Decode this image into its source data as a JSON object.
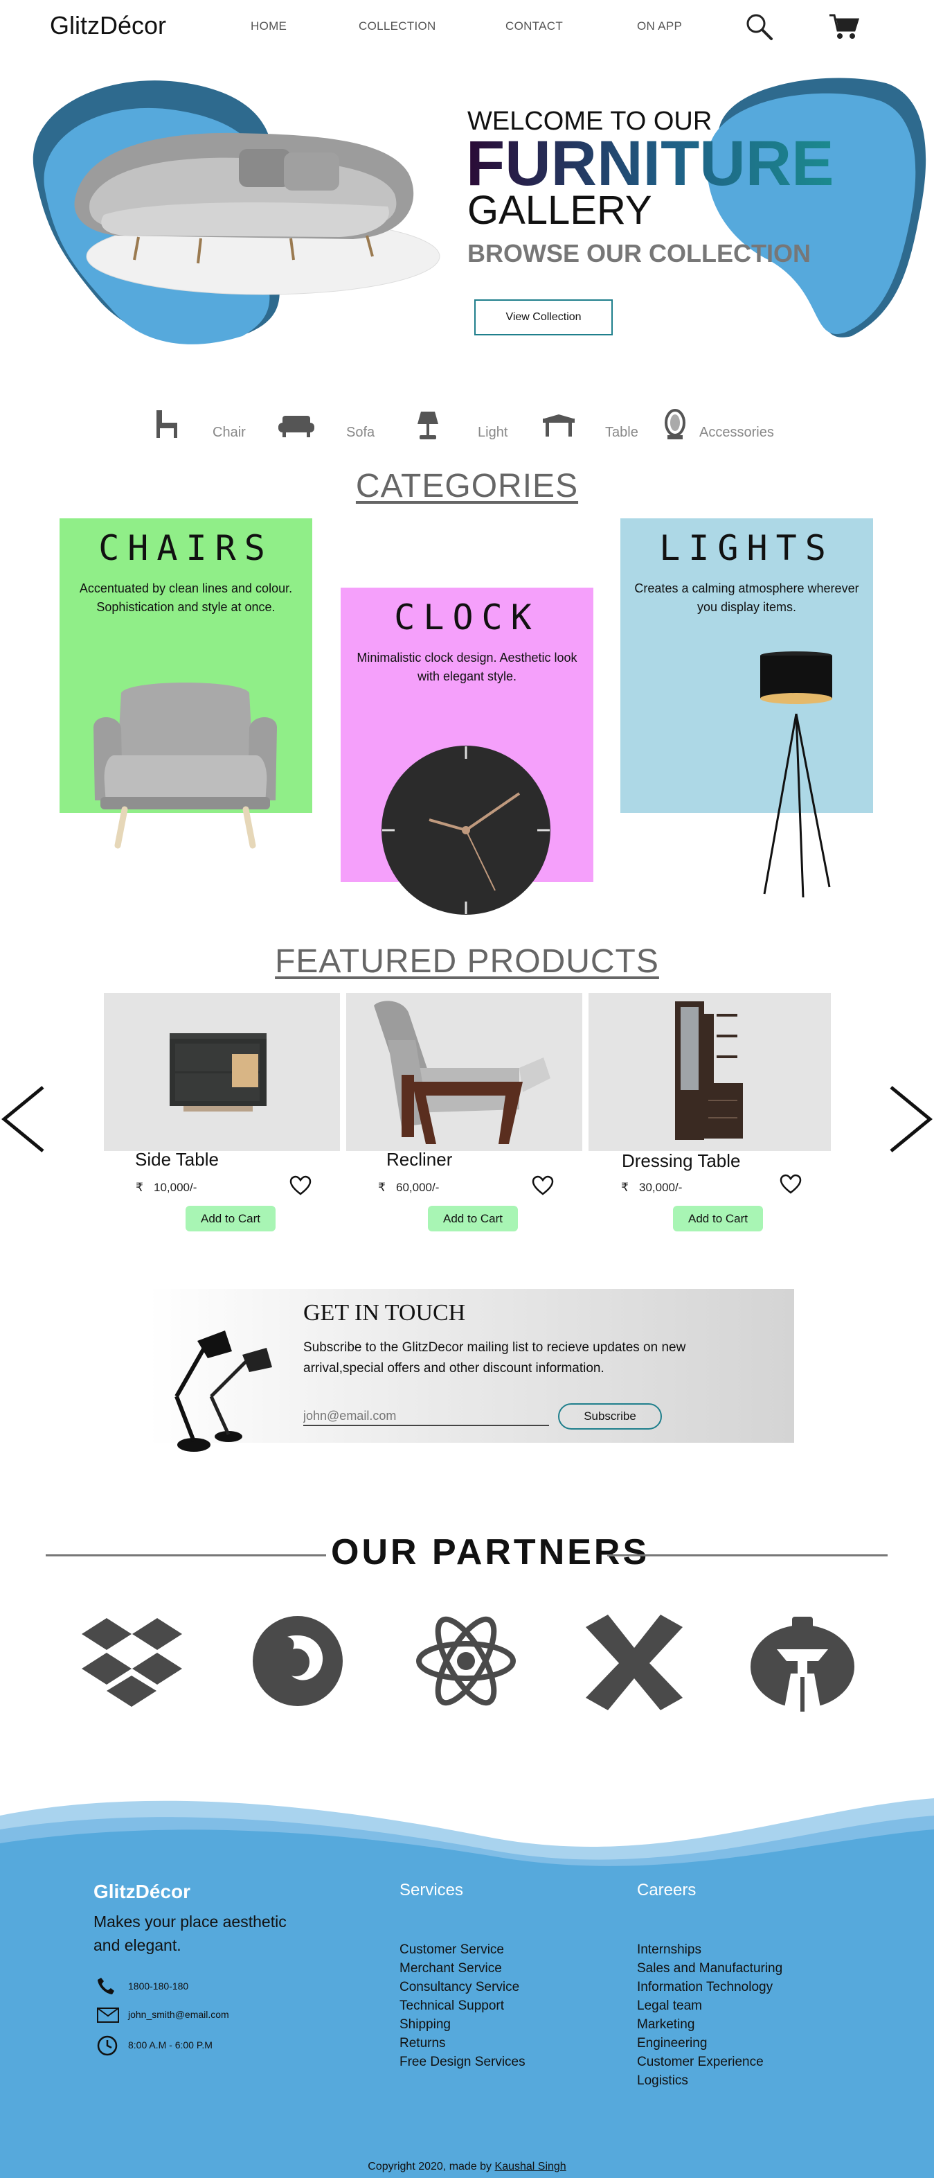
{
  "brand": "GlitzDécor",
  "nav": [
    "HOME",
    "COLLECTION",
    "CONTACT",
    "ON APP"
  ],
  "hero": {
    "welcome": "WELCOME TO OUR",
    "furniture": "FURNITURE",
    "gallery": "GALLERY",
    "browse": "BROWSE OUR COLLECTION",
    "cta": "View Collection"
  },
  "category_icons": [
    {
      "label": "Chair",
      "icon": "chair-icon"
    },
    {
      "label": "Sofa",
      "icon": "sofa-icon"
    },
    {
      "label": "Light",
      "icon": "lamp-icon"
    },
    {
      "label": "Table",
      "icon": "table-icon"
    },
    {
      "label": "Accessories",
      "icon": "mirror-icon"
    }
  ],
  "categories": {
    "heading": "CATEGORIES",
    "cards": [
      {
        "title": "CHAIRS",
        "text": "Accentuated by clean lines and colour. Sophistication and style at once.",
        "color": "#90ee88"
      },
      {
        "title": "CLOCK",
        "text": "Minimalistic clock design. Aesthetic look with elegant style.",
        "color": "#f5a0fb"
      },
      {
        "title": "LIGHTS",
        "text": "Creates a calming atmosphere wherever you display items.",
        "color": "#add8e6"
      }
    ]
  },
  "featured": {
    "heading": "FEATURED PRODUCTS",
    "currency_symbol": "₹",
    "add_label": "Add to Cart",
    "products": [
      {
        "name": "Side Table",
        "price": "10,000/-"
      },
      {
        "name": "Recliner",
        "price": "60,000/-"
      },
      {
        "name": "Dressing Table",
        "price": "30,000/-"
      }
    ]
  },
  "newsletter": {
    "title": "GET IN TOUCH",
    "text": "Subscribe to the GlitzDecor mailing list to recieve updates on new arrival,special offers and other discount information.",
    "placeholder": "john@email.com",
    "button": "Subscribe"
  },
  "partners": {
    "heading": "OUR PARTNERS",
    "logos": [
      "dropbox-icon",
      "firefox-icon",
      "react-icon",
      "xing-icon",
      "jenkins-icon"
    ]
  },
  "footer": {
    "brand": "GlitzDécor",
    "tagline": "Makes your place aesthetic and elegant.",
    "phone": "1800-180-180",
    "email": "john_smith@email.com",
    "hours": "8:00 A.M - 6:00 P.M",
    "services_title": "Services",
    "services": [
      "Customer Service",
      "Merchant Service",
      "Consultancy Service",
      "Technical Support",
      "Shipping",
      "Returns",
      "Free Design Services"
    ],
    "careers_title": "Careers",
    "careers": [
      "Internships",
      "Sales and Manufacturing",
      "Information Technology",
      "Legal team",
      "Marketing",
      "Engineering",
      "Customer Experience",
      "Logistics"
    ],
    "copyright": "Copyright 2020, made by",
    "author": "Kaushal Singh"
  },
  "colors": {
    "accent_blue": "#56a9dc",
    "dark_blue": "#2e6a8e",
    "teal": "#1f7f8c",
    "green_btn": "#a8f5b4"
  }
}
